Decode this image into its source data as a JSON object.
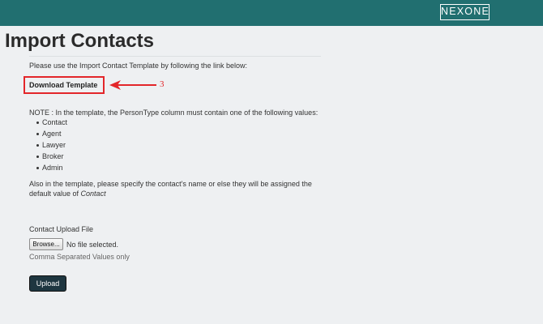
{
  "header": {
    "brand": "NEXONE",
    "bar_color": "#216f70"
  },
  "page": {
    "title": "Import Contacts",
    "intro": "Please use the Import Contact Template by following the link below:",
    "download_label": "Download Template",
    "annotation": {
      "step": "3",
      "color": "#e3262a"
    },
    "note": "NOTE : In the template, the PersonType column must contain one of the following values:",
    "person_types": [
      "Contact",
      "Agent",
      "Lawyer",
      "Broker",
      "Admin"
    ],
    "also_text": "Also in the template, please specify the contact's name or else they will be assigned the default value of ",
    "default_value": "Contact",
    "upload_label": "Contact Upload File",
    "browse_label": "Browse...",
    "file_status": "No file selected.",
    "csv_hint": "Comma Separated Values only",
    "upload_button": "Upload"
  }
}
